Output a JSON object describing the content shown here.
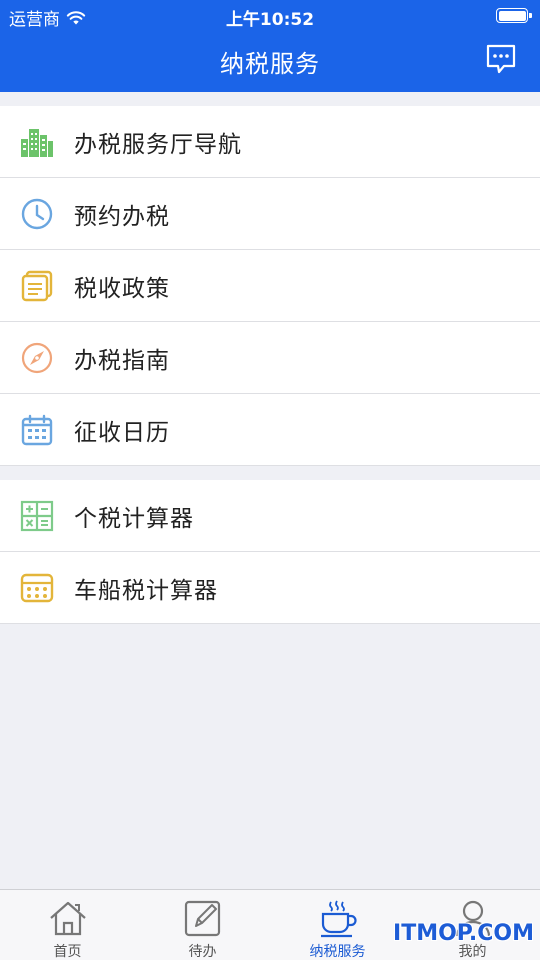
{
  "status_bar": {
    "carrier": "运营商",
    "time": "上午10:52"
  },
  "header": {
    "title": "纳税服务"
  },
  "groups": [
    {
      "items": [
        {
          "label": "办税服务厅导航",
          "icon": "building-icon",
          "color": "#6cc36a"
        },
        {
          "label": "预约办税",
          "icon": "clock-icon",
          "color": "#6aa6e0"
        },
        {
          "label": "税收政策",
          "icon": "document-icon",
          "color": "#e3b53a"
        },
        {
          "label": "办税指南",
          "icon": "compass-icon",
          "color": "#f0a57a"
        },
        {
          "label": "征收日历",
          "icon": "calendar-icon",
          "color": "#6aa6e0"
        }
      ]
    },
    {
      "items": [
        {
          "label": "个税计算器",
          "icon": "calculator-grid-icon",
          "color": "#7ecb8a"
        },
        {
          "label": "车船税计算器",
          "icon": "calculator-icon",
          "color": "#e3b53a"
        }
      ]
    }
  ],
  "tabbar": {
    "active": 2,
    "items": [
      {
        "label": "首页",
        "icon": "home-icon"
      },
      {
        "label": "待办",
        "icon": "edit-icon"
      },
      {
        "label": "纳税服务",
        "icon": "coffee-cup-icon"
      },
      {
        "label": "我的",
        "icon": "user-icon"
      }
    ]
  },
  "watermark": "ITMOP.COM",
  "colors": {
    "primary": "#1b64e8",
    "background": "#eff0f5"
  }
}
